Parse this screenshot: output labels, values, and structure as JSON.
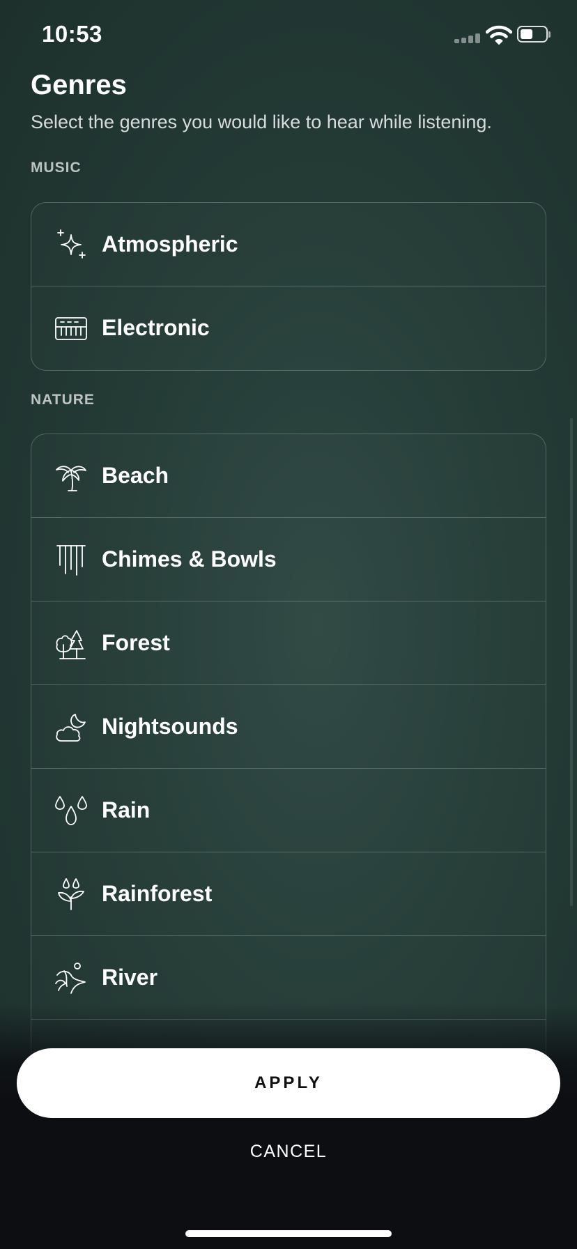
{
  "status_bar": {
    "time": "10:53"
  },
  "header": {
    "title": "Genres",
    "subtitle": "Select the genres you would like to hear while listening."
  },
  "sections": {
    "music": {
      "label": "MUSIC",
      "items": [
        {
          "label": "Atmospheric",
          "icon": "sparkles-icon"
        },
        {
          "label": "Electronic",
          "icon": "keyboard-icon"
        }
      ]
    },
    "nature": {
      "label": "NATURE",
      "items": [
        {
          "label": "Beach",
          "icon": "palm-tree-icon"
        },
        {
          "label": "Chimes & Bowls",
          "icon": "wind-chimes-icon"
        },
        {
          "label": "Forest",
          "icon": "trees-icon"
        },
        {
          "label": "Nightsounds",
          "icon": "moon-cloud-icon"
        },
        {
          "label": "Rain",
          "icon": "raindrops-icon"
        },
        {
          "label": "Rainforest",
          "icon": "plant-drops-icon"
        },
        {
          "label": "River",
          "icon": "river-icon"
        }
      ]
    }
  },
  "actions": {
    "apply_label": "APPLY",
    "cancel_label": "CANCEL"
  },
  "colors": {
    "background": "#243b36",
    "footer": "#0d0e12",
    "apply_button": "#ffffff"
  }
}
